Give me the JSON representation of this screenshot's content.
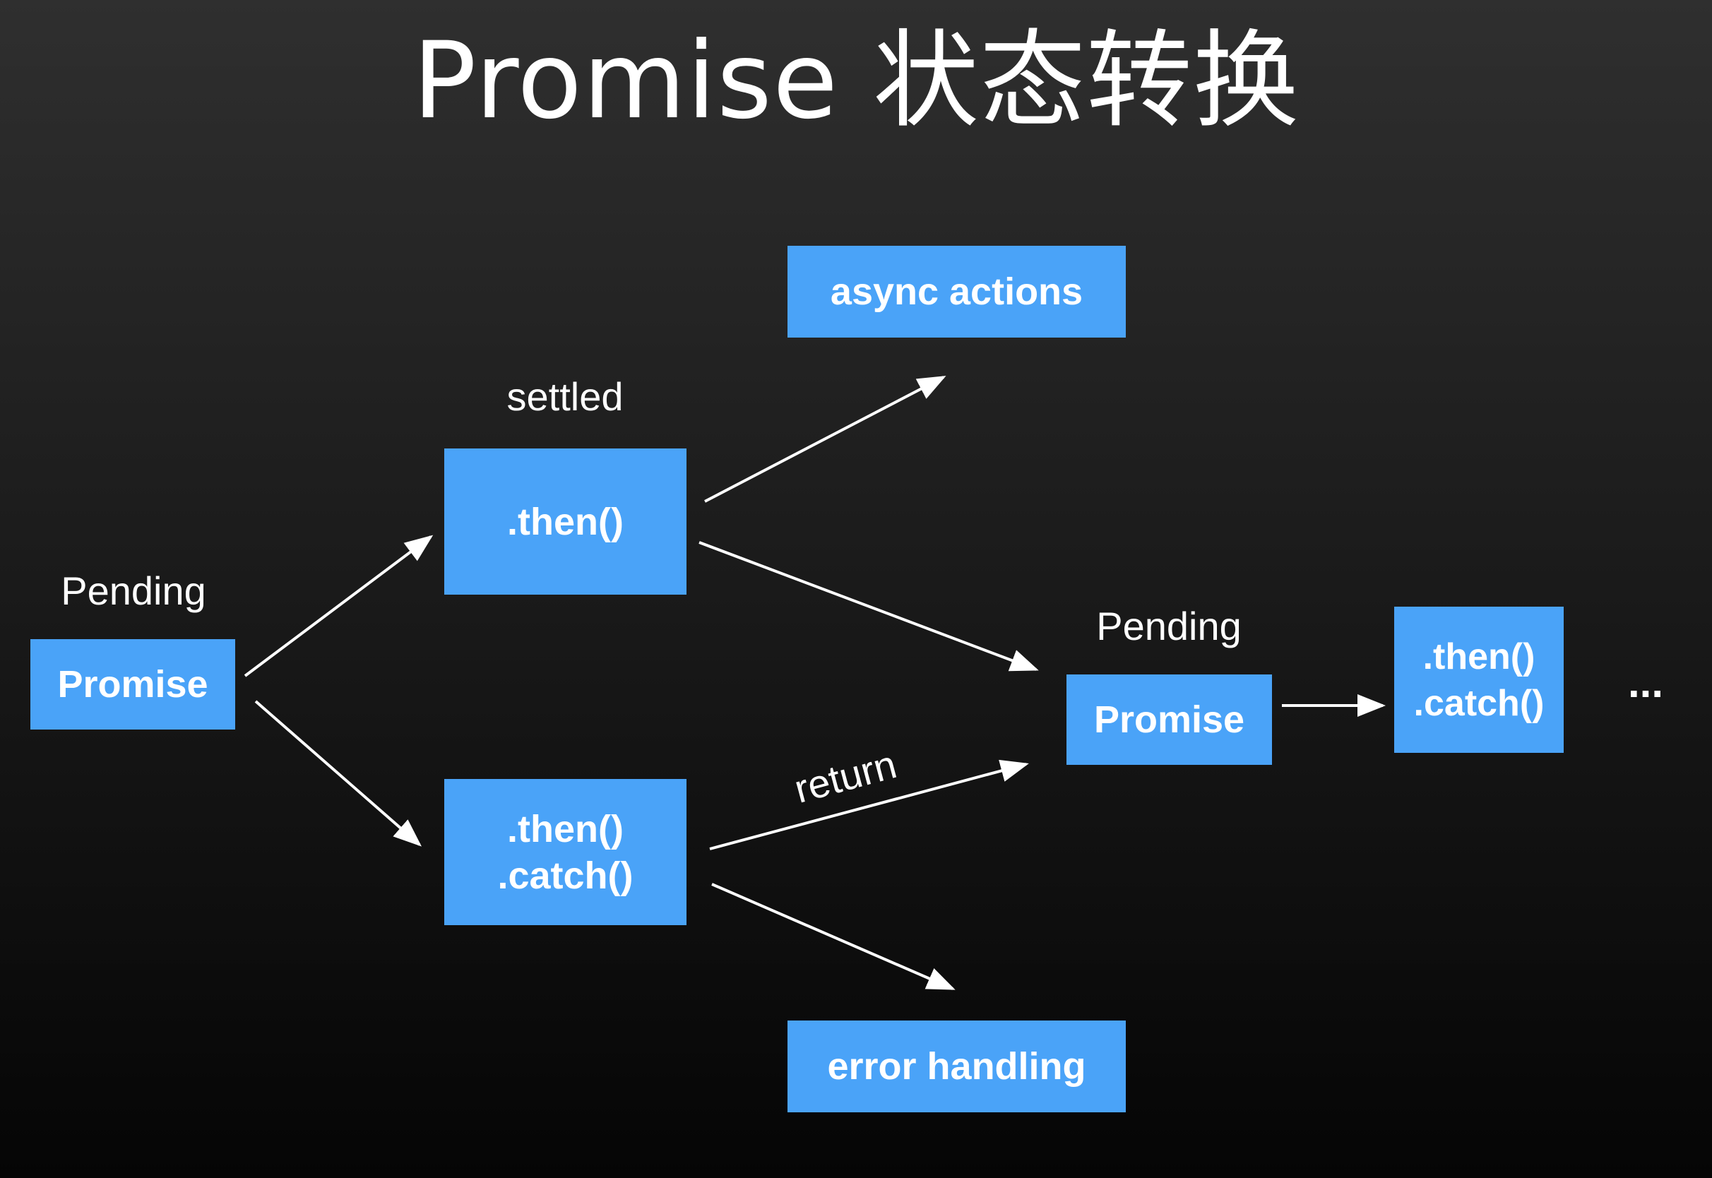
{
  "title": "Promise 状态转换",
  "nodes": {
    "promise_start": {
      "label": "Promise",
      "state": "Pending"
    },
    "then_box": {
      "label": ".then()",
      "state": "settled"
    },
    "then_catch_box": {
      "line1": ".then()",
      "line2": ".catch()"
    },
    "async_actions": {
      "label": "async actions"
    },
    "error_handling": {
      "label": "error handling"
    },
    "promise_next": {
      "label": "Promise",
      "state": "Pending"
    },
    "then_catch_next": {
      "line1": ".then()",
      "line2": ".catch()"
    },
    "ellipsis": "..."
  },
  "edges": {
    "return_label": "return"
  },
  "colors": {
    "box": "#4aa3f8",
    "text": "#ffffff",
    "arrow": "#ffffff"
  }
}
